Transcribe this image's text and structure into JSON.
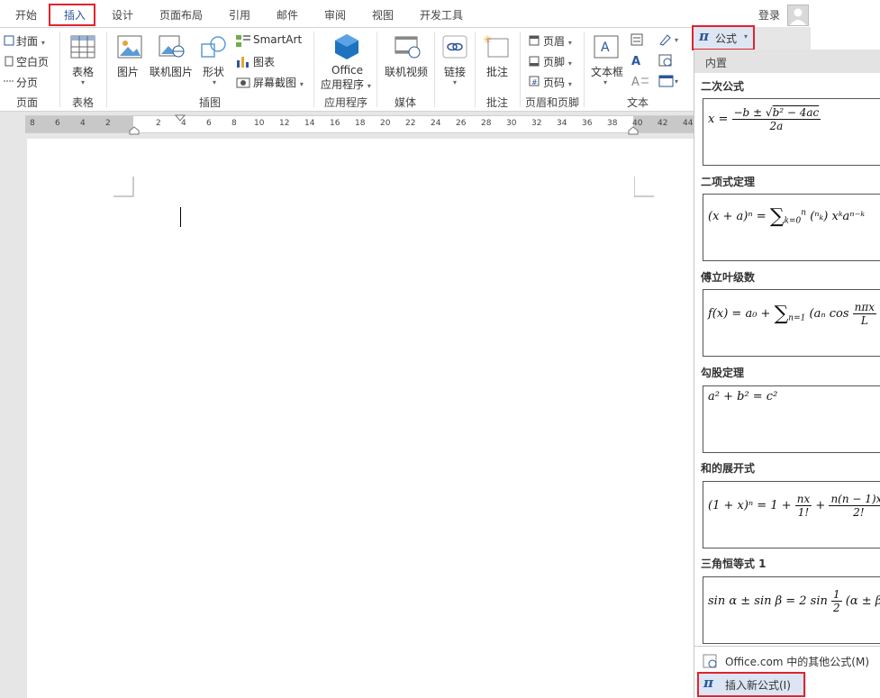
{
  "tabs": [
    "开始",
    "插入",
    "设计",
    "页面布局",
    "引用",
    "邮件",
    "审阅",
    "视图",
    "开发工具"
  ],
  "login": "登录",
  "ribbon": {
    "pages": {
      "cover": "封面",
      "blank": "空白页",
      "break": "分页",
      "label": "页面"
    },
    "table": {
      "button": "表格",
      "label": "表格"
    },
    "illus": {
      "picture": "图片",
      "online_picture": "联机图片",
      "shapes": "形状",
      "smartart": "SmartArt",
      "chart": "图表",
      "screenshot": "屏幕截图",
      "label": "插图"
    },
    "apps": {
      "office": "Office",
      "apps_btn": "应用程序",
      "label": "应用程序"
    },
    "media": {
      "video": "联机视频",
      "label": "媒体"
    },
    "links": {
      "link": "链接"
    },
    "comments": {
      "comment": "批注",
      "label": "批注"
    },
    "hf": {
      "header": "页眉",
      "footer": "页脚",
      "pagenum": "页码",
      "label": "页眉和页脚"
    },
    "text": {
      "textbox": "文本框",
      "label": "文本"
    },
    "equation": {
      "symbol": "π",
      "label": "公式"
    }
  },
  "ruler": [
    "8",
    "6",
    "4",
    "2",
    "2",
    "4",
    "6",
    "8",
    "10",
    "12",
    "14",
    "16",
    "18",
    "20",
    "22",
    "24",
    "26",
    "28",
    "30",
    "32",
    "34",
    "36",
    "38",
    "40",
    "42",
    "44"
  ],
  "panel": {
    "header": "内置",
    "items": [
      {
        "title": "二次公式"
      },
      {
        "title": "二项式定理"
      },
      {
        "title": "傅立叶级数"
      },
      {
        "title": "勾股定理"
      },
      {
        "title": "和的展开式"
      },
      {
        "title": "三角恒等式 1"
      }
    ],
    "more": "Office.com 中的其他公式(M)",
    "insert_new": "插入新公式(I)"
  },
  "colors": {
    "accent": "#2b579a",
    "highlight": "#e0242e"
  }
}
